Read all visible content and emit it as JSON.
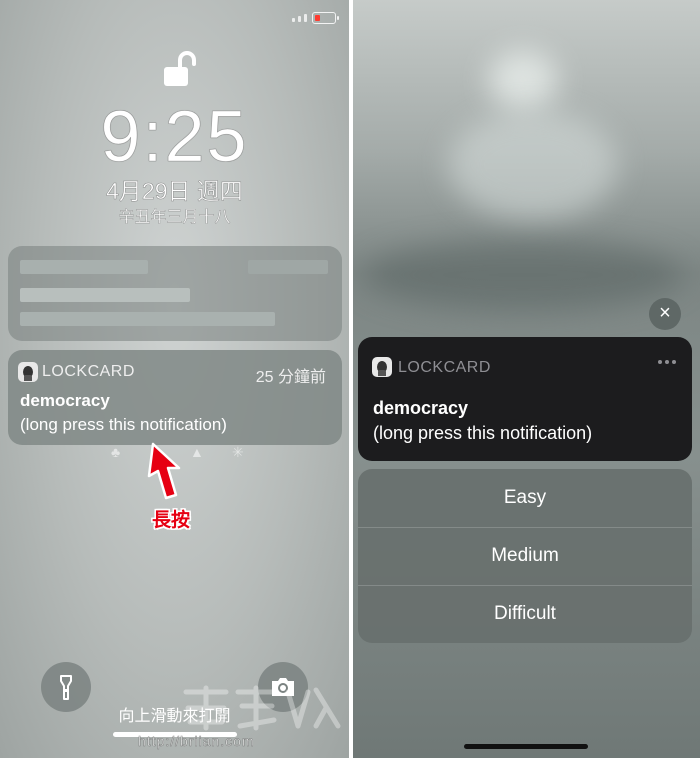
{
  "left_screen": {
    "status": {
      "battery_color": "#ff3b30"
    },
    "lock_icon": "unlocked-padlock-icon",
    "clock": "9:25",
    "date": "4月29日 週四",
    "lunar_date": "辛丑年三月十八",
    "notification": {
      "app_name": "LOCKCARD",
      "time_ago": "25 分鐘前",
      "title": "democracy",
      "body": "(long press this notification)"
    },
    "annotation": {
      "label": "長按",
      "color": "#e60012"
    },
    "swipe_hint": "向上滑動來打開",
    "buttons": [
      "flashlight-icon",
      "camera-icon"
    ]
  },
  "right_screen": {
    "close_icon": "×",
    "notification": {
      "app_name": "LOCKCARD",
      "title": "democracy",
      "body": "(long press this notification)"
    },
    "actions": [
      "Easy",
      "Medium",
      "Difficult"
    ]
  },
  "watermark": {
    "url": "http://briian.com"
  }
}
